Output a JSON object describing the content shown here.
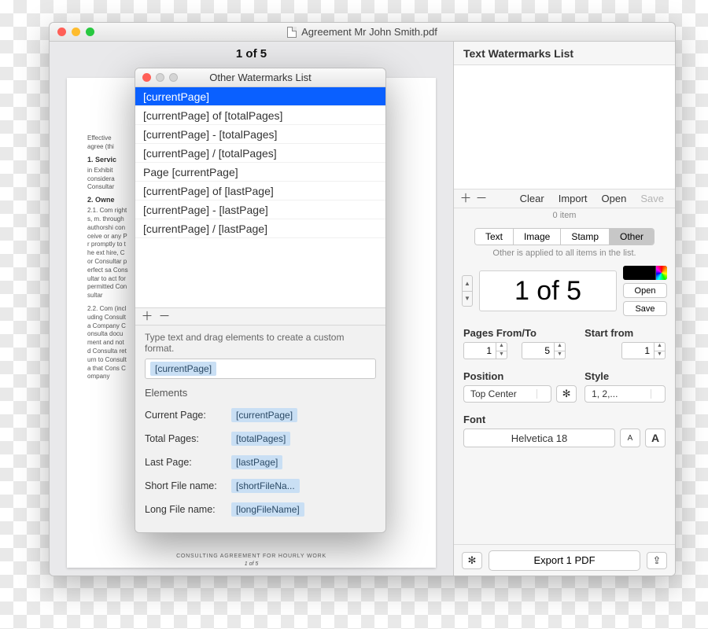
{
  "main": {
    "title": "Agreement Mr John Smith.pdf",
    "page_indicator": "1 of 5",
    "doc": {
      "effective": "Effective",
      "agree": "agree (thi",
      "s1": "1. Servic",
      "s1a": "in Exhibit",
      "s1b": "considera",
      "s1c": "Consultar",
      "s2": "2. Owne",
      "p1": "2.1. Com rights, m. through authorshi conceive or any Pr promptly to the ext hire, Cor Consultar perfect sa Consultar to act for permitted Consultar",
      "p2": "2.2. Com (including Consulta Company Consulta document and not d Consulta return to Consulta that Cons Company",
      "footer": "CONSULTING AGREEMENT FOR HOURLY WORK",
      "pagenum": "1 of 5"
    }
  },
  "panel": {
    "title": "Text Watermarks List",
    "btn_clear": "Clear",
    "btn_import": "Import",
    "btn_open": "Open",
    "btn_save": "Save",
    "item_count": "0 item",
    "tabs": {
      "text": "Text",
      "image": "Image",
      "stamp": "Stamp",
      "other": "Other"
    },
    "tab_caption": "Other is applied to all items in the list.",
    "preview_text": "1 of 5",
    "btn_open_wm": "Open",
    "btn_save_wm": "Save",
    "lbl_pages": "Pages From/To",
    "lbl_start": "Start from",
    "pages_from": "1",
    "pages_to": "5",
    "start_from": "1",
    "lbl_position": "Position",
    "lbl_style": "Style",
    "position_value": "Top Center",
    "style_value": "1, 2,...",
    "lbl_font": "Font",
    "font_value": "Helvetica 18",
    "small_a": "A",
    "big_a": "A",
    "export": "Export 1 PDF"
  },
  "dialog": {
    "title": "Other Watermarks List",
    "items": [
      "[currentPage]",
      "[currentPage] of [totalPages]",
      "[currentPage] - [totalPages]",
      "[currentPage] / [totalPages]",
      "Page [currentPage]",
      "[currentPage] of [lastPage]",
      "[currentPage] - [lastPage]",
      "[currentPage] / [lastPage]"
    ],
    "hint": "Type text and drag elements to create a custom format.",
    "input_token": "[currentPage]",
    "elements_title": "Elements",
    "elements": [
      {
        "label": "Current Page:",
        "token": "[currentPage]"
      },
      {
        "label": "Total Pages:",
        "token": "[totalPages]"
      },
      {
        "label": "Last Page:",
        "token": "[lastPage]"
      },
      {
        "label": "Short File name:",
        "token": "[shortFileNa..."
      },
      {
        "label": "Long File name:",
        "token": "[longFileName]"
      }
    ]
  }
}
